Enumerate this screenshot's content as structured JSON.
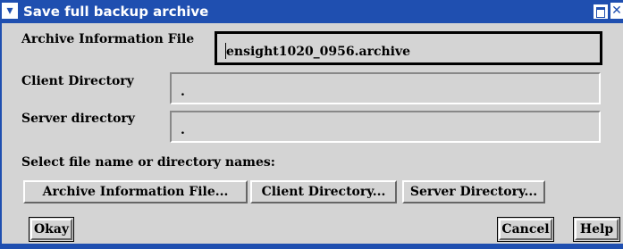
{
  "window": {
    "title": "Save full backup archive",
    "menu_icon": "chevron-down",
    "close_glyph": "✕"
  },
  "form": {
    "archive_info_label": "Archive Information File",
    "archive_info_value": "ensight1020_0956.archive",
    "client_dir_label": "Client Directory",
    "client_dir_value": ".",
    "server_dir_label": "Server directory",
    "server_dir_value": ".",
    "select_prompt": "Select file name or directory names:"
  },
  "buttons": {
    "archive_info_file": "Archive Information File...",
    "client_directory": "Client Directory...",
    "server_directory": "Server Directory...",
    "okay": "Okay",
    "cancel": "Cancel",
    "help": "Help"
  },
  "colors": {
    "titlebar": "#1f4fb0",
    "background": "#d4d4d4"
  }
}
